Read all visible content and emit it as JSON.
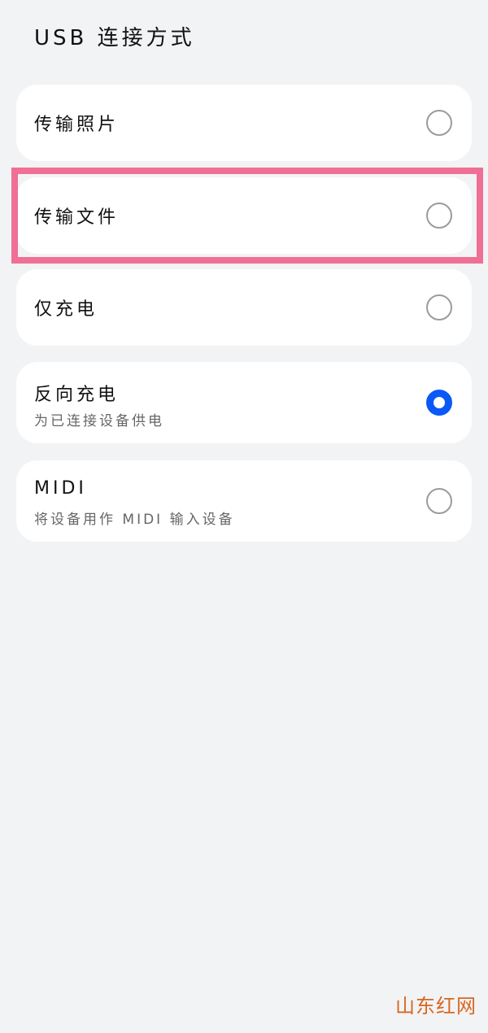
{
  "page": {
    "title": "USB 连接方式"
  },
  "options": [
    {
      "label": "传输照片",
      "subtitle": "",
      "selected": false
    },
    {
      "label": "传输文件",
      "subtitle": "",
      "selected": false
    },
    {
      "label": "仅充电",
      "subtitle": "",
      "selected": false
    },
    {
      "label": "反向充电",
      "subtitle": "为已连接设备供电",
      "selected": true
    },
    {
      "label": "MIDI",
      "subtitle": "将设备用作 MIDI 输入设备",
      "selected": false
    }
  ],
  "colors": {
    "background": "#f2f3f5",
    "accent": "#0a59f7",
    "highlight": "#ef6f95",
    "watermark": "#d9661f"
  },
  "watermark": {
    "text": "山东红网"
  }
}
